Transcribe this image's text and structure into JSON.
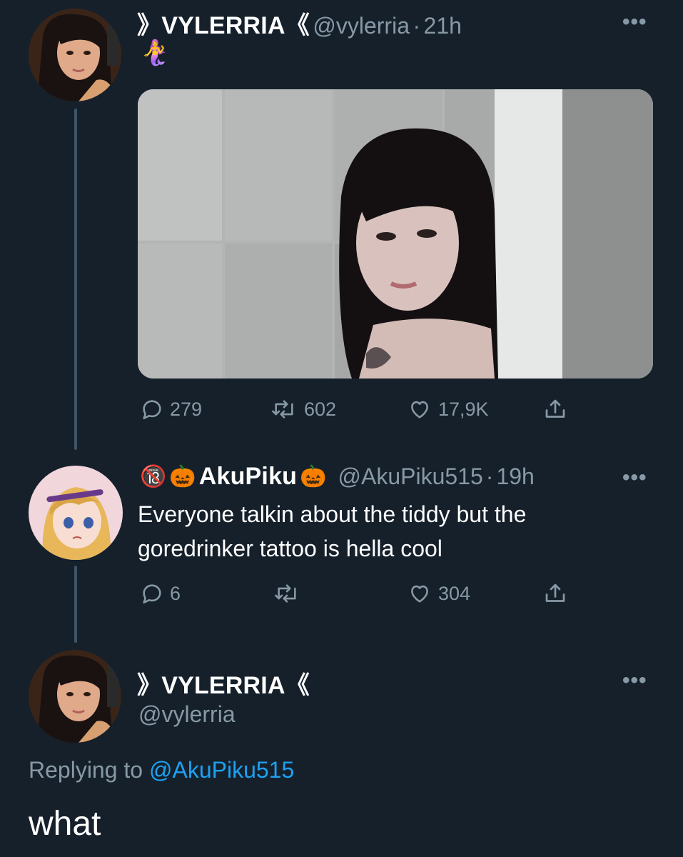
{
  "tweet1": {
    "display_name": "》VYLERRIA《",
    "handle": "@vylerria",
    "sep": "·",
    "time": "21h",
    "bio_emoji": "🧜‍♀️",
    "replies": "279",
    "retweets": "602",
    "likes": "17,9K"
  },
  "tweet2": {
    "badge": "🔞",
    "pumpkin": "🎃",
    "display_name": "AkuPiku",
    "handle": "@AkuPiku515",
    "sep": "·",
    "time": "19h",
    "text_line1": "Everyone talkin about the tiddy but the",
    "text_line2": "goredrinker tattoo is hella cool",
    "replies": "6",
    "retweets": "",
    "likes": "304"
  },
  "tweet3": {
    "display_name": "》VYLERRIA《",
    "handle": "@vylerria",
    "replying_prefix": "Replying to",
    "replying_handle": "@AkuPiku515",
    "text": "what"
  },
  "more_label": "•••",
  "colors": {
    "background": "#15202b",
    "muted": "#8899a6",
    "link": "#1da1f2",
    "thread_line": "#3d5466"
  }
}
